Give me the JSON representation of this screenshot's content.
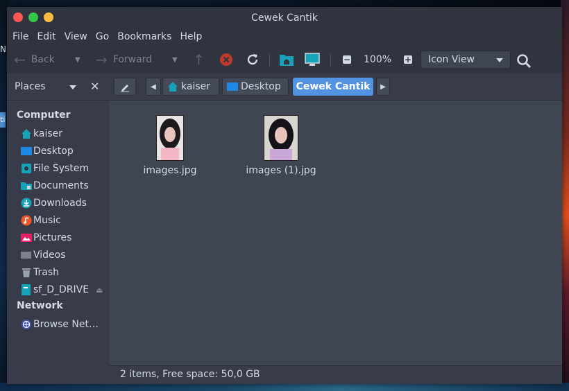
{
  "desktop": {
    "side_text_left": "NU",
    "side_chip": "ti"
  },
  "window": {
    "title": "Cewek Cantik"
  },
  "menubar": [
    "File",
    "Edit",
    "View",
    "Go",
    "Bookmarks",
    "Help"
  ],
  "toolbar": {
    "back": "Back",
    "forward": "Forward",
    "zoom": "100%",
    "view_mode": "Icon View"
  },
  "sidebar": {
    "header": "Places",
    "sections": [
      {
        "title": "Computer",
        "items": [
          {
            "label": "kaiser",
            "icon": "home-icon"
          },
          {
            "label": "Desktop",
            "icon": "desktop-folder-icon"
          },
          {
            "label": "File System",
            "icon": "drive-icon"
          },
          {
            "label": "Documents",
            "icon": "documents-folder-icon"
          },
          {
            "label": "Downloads",
            "icon": "download-icon"
          },
          {
            "label": "Music",
            "icon": "music-icon"
          },
          {
            "label": "Pictures",
            "icon": "pictures-icon"
          },
          {
            "label": "Videos",
            "icon": "video-icon"
          },
          {
            "label": "Trash",
            "icon": "trash-icon"
          },
          {
            "label": "sf_D_DRIVE",
            "icon": "shared-drive-icon"
          }
        ]
      },
      {
        "title": "Network",
        "items": [
          {
            "label": "Browse Network",
            "icon": "network-icon"
          }
        ]
      }
    ]
  },
  "pathbar": {
    "crumbs": [
      "kaiser",
      "Desktop",
      "Cewek Cantik"
    ],
    "active": "Cewek Cantik"
  },
  "files": [
    {
      "name": "images.jpg"
    },
    {
      "name": "images (1).jpg"
    }
  ],
  "status": "2 items, Free space: 50,0 GB",
  "colors": {
    "accent": "#5294e2",
    "panel": "#2f343f",
    "view_bg": "#404552",
    "folder_teal": "#16a3b8"
  }
}
